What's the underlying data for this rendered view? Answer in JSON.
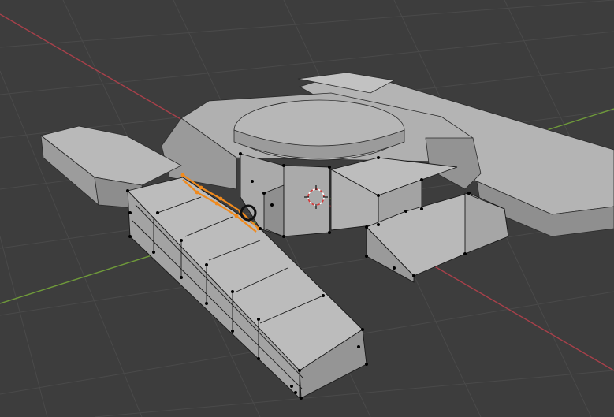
{
  "viewport": {
    "view": "3d-viewport",
    "mode": "edit-mode",
    "colors": {
      "background": "#3d3d3d",
      "grid_line": "#4a4a4a",
      "x_axis": "#a8404a",
      "y_axis": "#6f9a3a",
      "mesh_light": "#b9b9b9",
      "mesh_mid": "#a2a2a2",
      "mesh_dark": "#8e8e8e",
      "edge": "#1a1a1a",
      "vertex": "#000000",
      "selection": "#f08a1d",
      "cursor_red": "#d33a3a"
    },
    "icons": [
      "3d-cursor-icon"
    ]
  }
}
